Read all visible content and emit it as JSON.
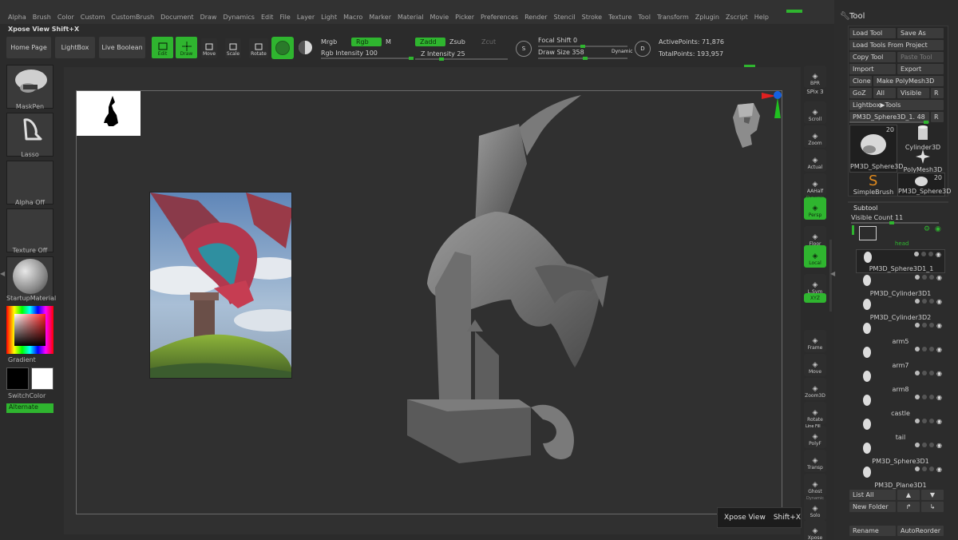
{
  "menu": [
    "Alpha",
    "Brush",
    "Color",
    "Custom",
    "CustomBrush",
    "Document",
    "Draw",
    "Dynamics",
    "Edit",
    "File",
    "Layer",
    "Light",
    "Macro",
    "Marker",
    "Material",
    "Movie",
    "Picker",
    "Preferences",
    "Render",
    "Stencil",
    "Stroke",
    "Texture",
    "Tool",
    "Transform",
    "Zplugin",
    "Zscript",
    "Help"
  ],
  "xpose_shortcut_label": "Xpose View Shift+X",
  "shelf": {
    "home_page": "Home Page",
    "lightbox": "LightBox",
    "live_boolean": "Live Boolean",
    "edit": "Edit",
    "draw": "Draw",
    "move": "Move",
    "scale": "Scale",
    "rotate": "Rotate",
    "mrgb": "Mrgb",
    "rgb": "Rgb",
    "m": "M",
    "rgb_intensity_label": "Rgb Intensity",
    "rgb_intensity_value": "100",
    "zadd": "Zadd",
    "zsub": "Zsub",
    "zcut": "Zcut",
    "z_intensity_label": "Z Intensity",
    "z_intensity_value": "25",
    "focal_shift_label": "Focal Shift",
    "focal_shift_value": "0",
    "draw_size_label": "Draw Size",
    "draw_size_value": "358",
    "dynamic": "Dynamic",
    "s_key": "S",
    "d_key": "D",
    "active_points": "ActivePoints: 71,876",
    "total_points": "TotalPoints: 193,957"
  },
  "left_tray": {
    "brush": "MaskPen",
    "stroke": "Lasso",
    "alpha": "Alpha Off",
    "texture": "Texture Off",
    "material": "StartupMaterial",
    "gradient": "Gradient",
    "switch_color": "SwitchColor",
    "alternate": "Alternate"
  },
  "right_shelf": [
    {
      "name": "bpr-button",
      "label": "BPR"
    },
    {
      "name": "spix-label",
      "label": "SPix 3"
    },
    {
      "name": "scroll-button",
      "label": "Scroll"
    },
    {
      "name": "zoom-button",
      "label": "Zoom"
    },
    {
      "name": "actual-button",
      "label": "Actual"
    },
    {
      "name": "aahalf-button",
      "label": "AAHalf"
    },
    {
      "name": "persp-button",
      "label": "Persp"
    },
    {
      "name": "floor-button",
      "label": "Floor"
    },
    {
      "name": "local-button",
      "label": "Local"
    },
    {
      "name": "lsym-button",
      "label": "L.Sym"
    },
    {
      "name": "xyz-button",
      "label": "XYZ"
    },
    {
      "name": "frame-button",
      "label": "Frame"
    },
    {
      "name": "move-view-button",
      "label": "Move"
    },
    {
      "name": "zoom3d-button",
      "label": "Zoom3D"
    },
    {
      "name": "rotate-view-button",
      "label": "Rotate"
    },
    {
      "name": "polyf-button",
      "label": "PolyF"
    },
    {
      "name": "transp-button",
      "label": "Transp"
    },
    {
      "name": "ghost-button",
      "label": "Ghost"
    },
    {
      "name": "solo-button",
      "label": "Solo"
    },
    {
      "name": "xpose-button",
      "label": "Xpose"
    }
  ],
  "right_shelf_extra": {
    "dynamic": "Dynamic",
    "line_fill": "Line Fill",
    "dynamic2": "Dynamic"
  },
  "tool": {
    "title": "Tool",
    "load_tool": "Load Tool",
    "save_as": "Save As",
    "load_from_project": "Load Tools From Project",
    "copy_tool": "Copy Tool",
    "paste_tool": "Paste Tool",
    "import": "Import",
    "export": "Export",
    "clone": "Clone",
    "make_polymesh": "Make PolyMesh3D",
    "goz": "GoZ",
    "all": "All",
    "visible": "Visible",
    "r": "R",
    "lightbox_tools": "Lightbox▶Tools",
    "current_tool": "PM3D_Sphere3D_1. 48",
    "r2": "R",
    "thumbs": [
      {
        "label": "PM3D_Sphere3D",
        "count": "20"
      },
      {
        "label": "Cylinder3D",
        "count": ""
      },
      {
        "label": "PolyMesh3D",
        "count": ""
      },
      {
        "label": "SimpleBrush",
        "count": ""
      },
      {
        "label": "PM3D_Sphere3D",
        "count": "20"
      }
    ]
  },
  "subtool": {
    "title": "Subtool",
    "visible_count": "Visible Count 11",
    "folder_label": "head",
    "items": [
      "PM3D_Sphere3D1_1",
      "PM3D_Cylinder3D1",
      "PM3D_Cylinder3D2",
      "arm5",
      "arm7",
      "arm8",
      "castle",
      "tail",
      "PM3D_Sphere3D1",
      "PM3D_Plane3D1"
    ],
    "list_all": "List All",
    "new_folder": "New Folder",
    "rename": "Rename",
    "auto_reorder": "AutoReorder"
  },
  "tooltip": {
    "text": "Xpose View",
    "shortcut": "Shift+X"
  },
  "colors": {
    "accent": "#2fb52f",
    "panel": "#2c2c2c",
    "canvas": "#303030"
  }
}
